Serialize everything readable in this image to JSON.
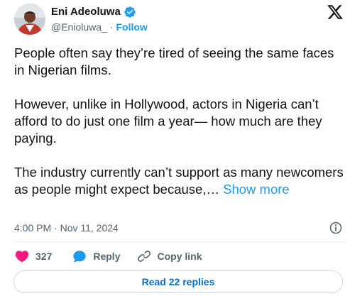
{
  "author": {
    "display_name": "Eni Adeoluwa",
    "handle": "@Enioluwa_",
    "separator": "·",
    "follow_label": "Follow",
    "verified": true
  },
  "icons": {
    "verified": "verified-badge-icon",
    "brand": "x-logo-icon",
    "info": "info-icon",
    "like": "heart-icon",
    "reply": "reply-bubble-icon",
    "copy_link": "link-icon"
  },
  "colors": {
    "accent": "#1d9bf0",
    "like": "#f91880",
    "muted": "#536471",
    "text": "#0f1419"
  },
  "tweet": {
    "paragraphs": [
      "People often say they’re tired of seeing the same faces in Nigerian films.",
      "However, unlike in Hollywood, actors in Nigeria can’t afford to do just one film a year— how much are they paying."
    ],
    "last_paragraph": "The industry currently can’t support as many newcomers as people might expect because,…",
    "show_more_label": "Show more",
    "timestamp": "4:00 PM · Nov 11, 2024"
  },
  "actions": {
    "like_count": "327",
    "reply_label": "Reply",
    "copy_link_label": "Copy link"
  },
  "read_replies_label": "Read 22 replies"
}
